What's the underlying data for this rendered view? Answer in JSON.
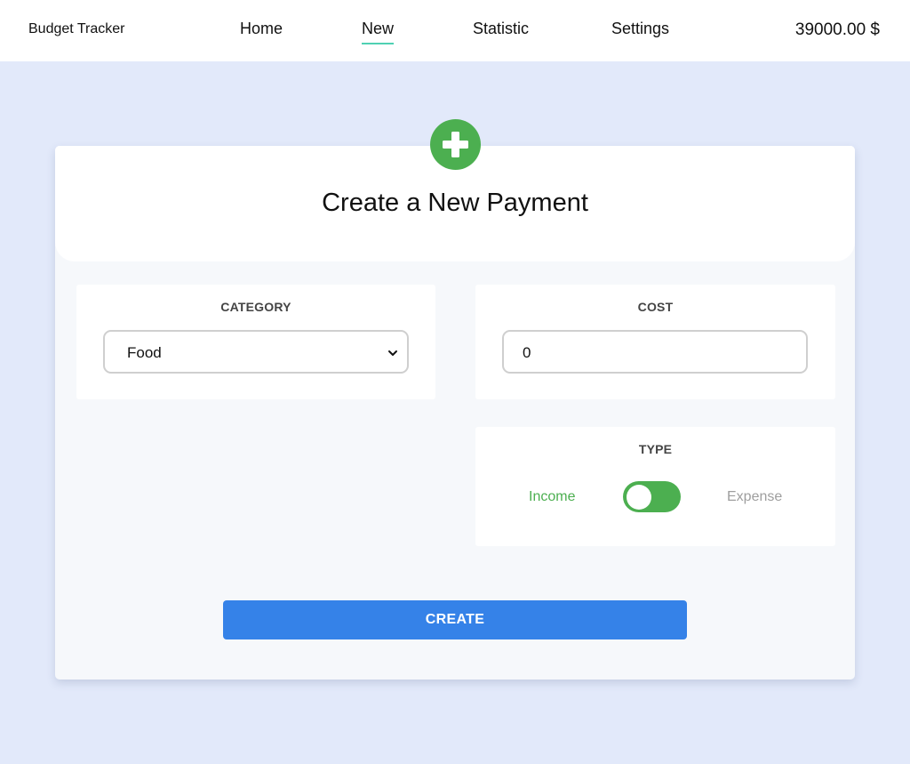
{
  "navbar": {
    "brand": "Budget Tracker",
    "links": [
      {
        "label": "Home",
        "active": false
      },
      {
        "label": "New",
        "active": true
      },
      {
        "label": "Statistic",
        "active": false
      },
      {
        "label": "Settings",
        "active": false
      }
    ],
    "balance": "39000.00 $"
  },
  "form": {
    "icon": "plus-icon",
    "title": "Create a New Payment",
    "category": {
      "label": "CATEGORY",
      "selected": "Food"
    },
    "cost": {
      "label": "COST",
      "value": "0"
    },
    "type": {
      "label": "TYPE",
      "income_label": "Income",
      "expense_label": "Expense",
      "selected": "Income"
    },
    "submit_label": "CREATE"
  },
  "colors": {
    "accent_green": "#4caf50",
    "button_blue": "#3582e8",
    "nav_underline": "#4fd1b3",
    "page_background": "#e2e9fa",
    "muted_text": "#9e9e9e"
  }
}
